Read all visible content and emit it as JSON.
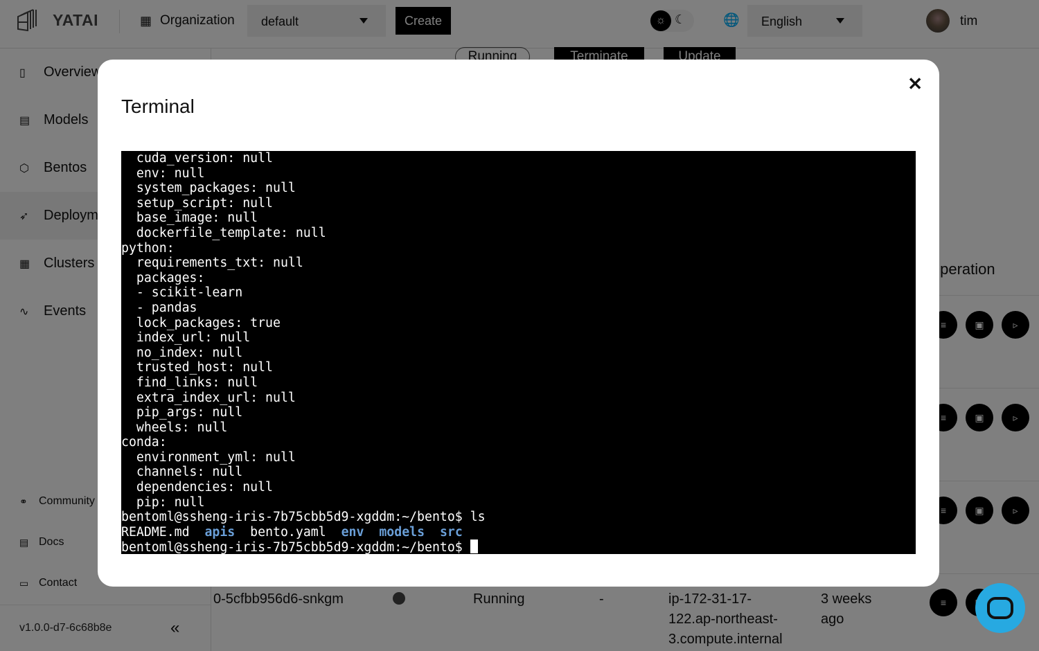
{
  "header": {
    "brand": "YATAI",
    "organization_label": "Organization",
    "organization_value": "default",
    "create_label": "Create",
    "language_value": "English",
    "username": "tim"
  },
  "sidebar": {
    "items": [
      {
        "label": "Overview",
        "icon": "clipboard-icon"
      },
      {
        "label": "Models",
        "icon": "box-icon"
      },
      {
        "label": "Bentos",
        "icon": "cube-icon"
      },
      {
        "label": "Deployments",
        "icon": "rocket-icon"
      },
      {
        "label": "Clusters",
        "icon": "server-icon"
      },
      {
        "label": "Events",
        "icon": "activity-icon"
      }
    ],
    "footer": [
      {
        "label": "Community",
        "icon": "community-icon"
      },
      {
        "label": "Docs",
        "icon": "document-icon"
      },
      {
        "label": "Contact",
        "icon": "chat-icon"
      }
    ],
    "version": "v1.0.0-d7-6c68b8e"
  },
  "background": {
    "status_pill": "Running",
    "terminate_label": "Terminate",
    "update_label": "Update",
    "operation_header": "Operation",
    "last_row": {
      "pod": "0-5cfbb956d6-snkgm",
      "status": "Running",
      "dash": "-",
      "node": [
        "ip-172-31-17-",
        "122.ap-northeast-",
        "3.compute.internal"
      ],
      "age": [
        "3 weeks",
        "ago"
      ]
    }
  },
  "modal": {
    "title": "Terminal",
    "terminal": {
      "lines": [
        "  cuda_version: null",
        "  env: null",
        "  system_packages: null",
        "  setup_script: null",
        "  base_image: null",
        "  dockerfile_template: null",
        "python:",
        "  requirements_txt: null",
        "  packages:",
        "  - scikit-learn",
        "  - pandas",
        "  lock_packages: true",
        "  index_url: null",
        "  no_index: null",
        "  trusted_host: null",
        "  find_links: null",
        "  extra_index_url: null",
        "  pip_args: null",
        "  wheels: null",
        "conda:",
        "  environment_yml: null",
        "  channels: null",
        "  dependencies: null",
        "  pip: null",
        "bentoml@ssheng-iris-7b75cbb5d9-xgddm:~/bento$ ls"
      ],
      "ls_output": [
        {
          "text": "README.md  ",
          "color": "#ffffff",
          "bold": false
        },
        {
          "text": "apis",
          "color": "#6a9fd8",
          "bold": true
        },
        {
          "text": "  bento.yaml  ",
          "color": "#ffffff",
          "bold": false
        },
        {
          "text": "env",
          "color": "#6a9fd8",
          "bold": true
        },
        {
          "text": "  ",
          "color": "#ffffff",
          "bold": false
        },
        {
          "text": "models",
          "color": "#6a9fd8",
          "bold": true
        },
        {
          "text": "  ",
          "color": "#ffffff",
          "bold": false
        },
        {
          "text": "src",
          "color": "#6a9fd8",
          "bold": true
        }
      ],
      "prompt": "bentoml@ssheng-iris-7b75cbb5d9-xgddm:~/bento$ "
    }
  },
  "colors": {
    "chat_button": "#27a9e1",
    "directory": "#6a9fd8"
  }
}
